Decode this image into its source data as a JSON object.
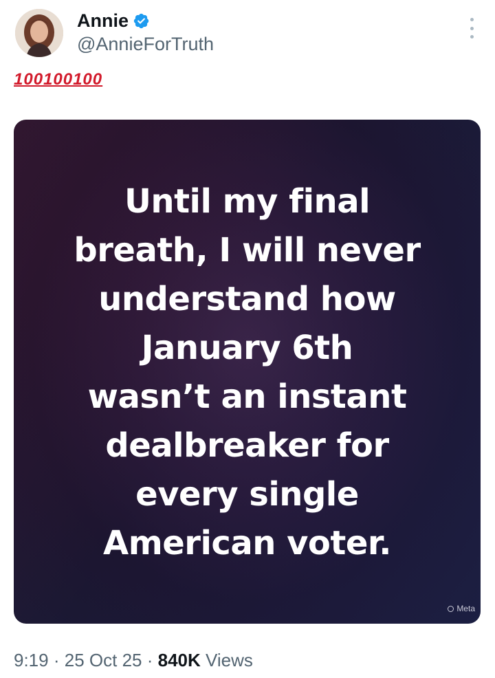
{
  "author": {
    "display_name": "Annie",
    "handle": "@AnnieForTruth",
    "verified": true
  },
  "tweet": {
    "text": "💯💯💯",
    "text_display": "100100100",
    "media": {
      "quote_lines": [
        "Until my final",
        "breath, I will never",
        "understand how",
        "January 6th",
        "wasn’t an instant",
        "dealbreaker for",
        "every single",
        "American voter."
      ],
      "watermark": "Meta"
    },
    "time": "9:19",
    "separator": "·",
    "date": "25 Oct 25",
    "views_count": "840K",
    "views_label": "Views"
  },
  "icons": {
    "verified": "verified-badge-icon",
    "more": "more-options-icon",
    "watermark": "meta-ring-icon"
  },
  "colors": {
    "verified_blue": "#1d9bf0",
    "secondary_text": "#536471",
    "primary_text": "#0f1419",
    "emoji_red": "#d21a2b"
  }
}
